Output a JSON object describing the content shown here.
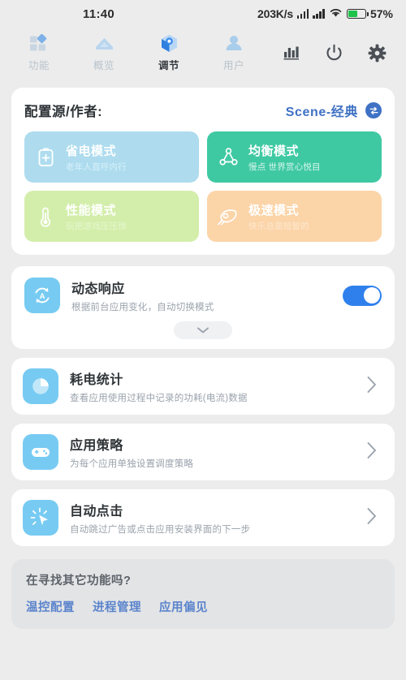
{
  "statusbar": {
    "time": "11:40",
    "net_speed": "203K/s",
    "battery_pct": "57%",
    "battery_level": 57,
    "signal_icon": "signal-bars-icon",
    "wifi_icon": "wifi-icon",
    "battery_icon": "battery-icon"
  },
  "topnav": {
    "tabs": [
      {
        "label": "功能",
        "icon": "blocks-icon",
        "active": false
      },
      {
        "label": "概览",
        "icon": "home-icon",
        "active": false
      },
      {
        "label": "调节",
        "icon": "hexagon-icon",
        "active": true
      },
      {
        "label": "用户",
        "icon": "user-icon",
        "active": false
      }
    ],
    "actions": [
      {
        "name": "chart-icon"
      },
      {
        "name": "power-icon"
      },
      {
        "name": "gear-icon"
      }
    ]
  },
  "config": {
    "title": "配置源/作者:",
    "source": "Scene-经典",
    "swap_icon": "swap-icon",
    "modes": [
      {
        "name": "省电模式",
        "sub": "老年人直呼内行",
        "icon": "battery-plus-icon",
        "color": "#aedcee",
        "selected": false
      },
      {
        "name": "均衡模式",
        "sub": "慢点 世界赏心悦目",
        "icon": "triangle-nodes-icon",
        "color": "#3fc9a3",
        "selected": true
      },
      {
        "name": "性能模式",
        "sub": "玩把游戏压压惊",
        "icon": "thermometer-icon",
        "color": "#d3eeab",
        "selected": false
      },
      {
        "name": "极速模式",
        "sub": "快乐总是短暂的",
        "icon": "rocket-icon",
        "color": "#fbd4a8",
        "selected": false
      }
    ]
  },
  "dynamic": {
    "title": "动态响应",
    "sub": "根据前台应用变化，自动切换模式",
    "icon": "auto-refresh-icon",
    "toggle_on": true,
    "expand_icon": "chevron-down-icon"
  },
  "rows": [
    {
      "title": "耗电统计",
      "sub": "查看应用使用过程中记录的功耗(电流)数据",
      "icon": "pie-chart-icon"
    },
    {
      "title": "应用策略",
      "sub": "为每个应用单独设置调度策略",
      "icon": "gamepad-icon"
    },
    {
      "title": "自动点击",
      "sub": "自动跳过广告或点击应用安装界面的下一步",
      "icon": "cursor-click-icon"
    }
  ],
  "footer": {
    "question": "在寻找其它功能吗?",
    "links": [
      "温控配置",
      "进程管理",
      "应用偏见"
    ]
  },
  "colors": {
    "accent_blue": "#2f80ed",
    "link_blue": "#5b84cc",
    "source_blue": "#3f72c4",
    "icon_blue": "#77cbf2",
    "battery_green": "#1fc24a",
    "page_bg": "#ececec"
  }
}
